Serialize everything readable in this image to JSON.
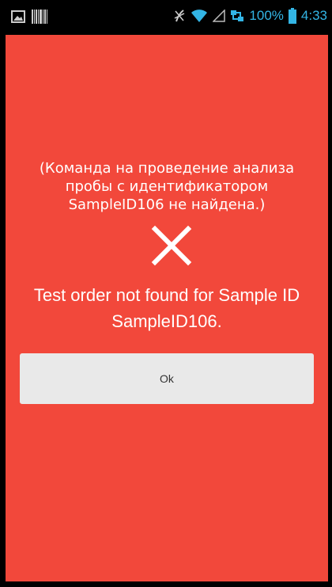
{
  "status_bar": {
    "icons_left": [
      "image-icon",
      "barcode-icon"
    ],
    "icons_right": [
      "mute-icon",
      "wifi-icon",
      "signal-icon",
      "network-icon",
      "battery-icon"
    ],
    "battery": "100%",
    "time": "4:33",
    "accent_color": "#33b5e5"
  },
  "dialog": {
    "background_color": "#f2483b",
    "ru_message": "(Команда на проведение анализа\nпробы с идентификатором\nSampleID106 не найдена.)",
    "icon": "close-x-icon",
    "en_message": "Test order not found for Sample ID\nSampleID106.",
    "ok_label": "Ok"
  }
}
